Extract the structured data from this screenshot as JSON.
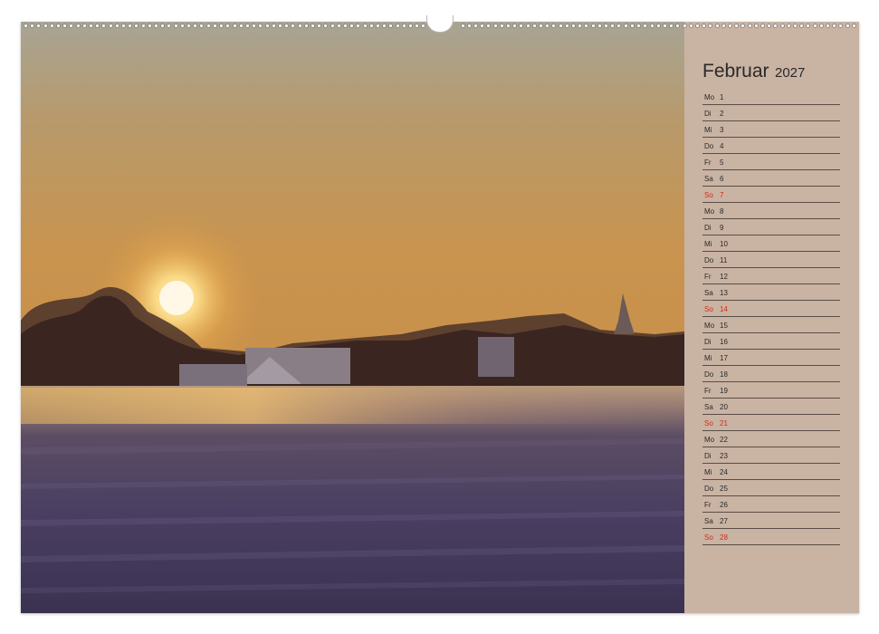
{
  "calendar": {
    "month": "Februar",
    "year": "2027",
    "sunday_color": "#d42a1c",
    "panel_color": "#c9b3a3",
    "days": [
      {
        "name": "Mo",
        "date": "1"
      },
      {
        "name": "Di",
        "date": "2"
      },
      {
        "name": "Mi",
        "date": "3"
      },
      {
        "name": "Do",
        "date": "4"
      },
      {
        "name": "Fr",
        "date": "5"
      },
      {
        "name": "Sa",
        "date": "6"
      },
      {
        "name": "So",
        "date": "7",
        "sunday": true
      },
      {
        "name": "Mo",
        "date": "8"
      },
      {
        "name": "Di",
        "date": "9"
      },
      {
        "name": "Mi",
        "date": "10"
      },
      {
        "name": "Do",
        "date": "11"
      },
      {
        "name": "Fr",
        "date": "12"
      },
      {
        "name": "Sa",
        "date": "13"
      },
      {
        "name": "So",
        "date": "14",
        "sunday": true
      },
      {
        "name": "Mo",
        "date": "15"
      },
      {
        "name": "Di",
        "date": "16"
      },
      {
        "name": "Mi",
        "date": "17"
      },
      {
        "name": "Do",
        "date": "18"
      },
      {
        "name": "Fr",
        "date": "19"
      },
      {
        "name": "Sa",
        "date": "20"
      },
      {
        "name": "So",
        "date": "21",
        "sunday": true
      },
      {
        "name": "Mo",
        "date": "22"
      },
      {
        "name": "Di",
        "date": "23"
      },
      {
        "name": "Mi",
        "date": "24"
      },
      {
        "name": "Do",
        "date": "25"
      },
      {
        "name": "Fr",
        "date": "26"
      },
      {
        "name": "Sa",
        "date": "27"
      },
      {
        "name": "So",
        "date": "28",
        "sunday": true
      }
    ]
  }
}
